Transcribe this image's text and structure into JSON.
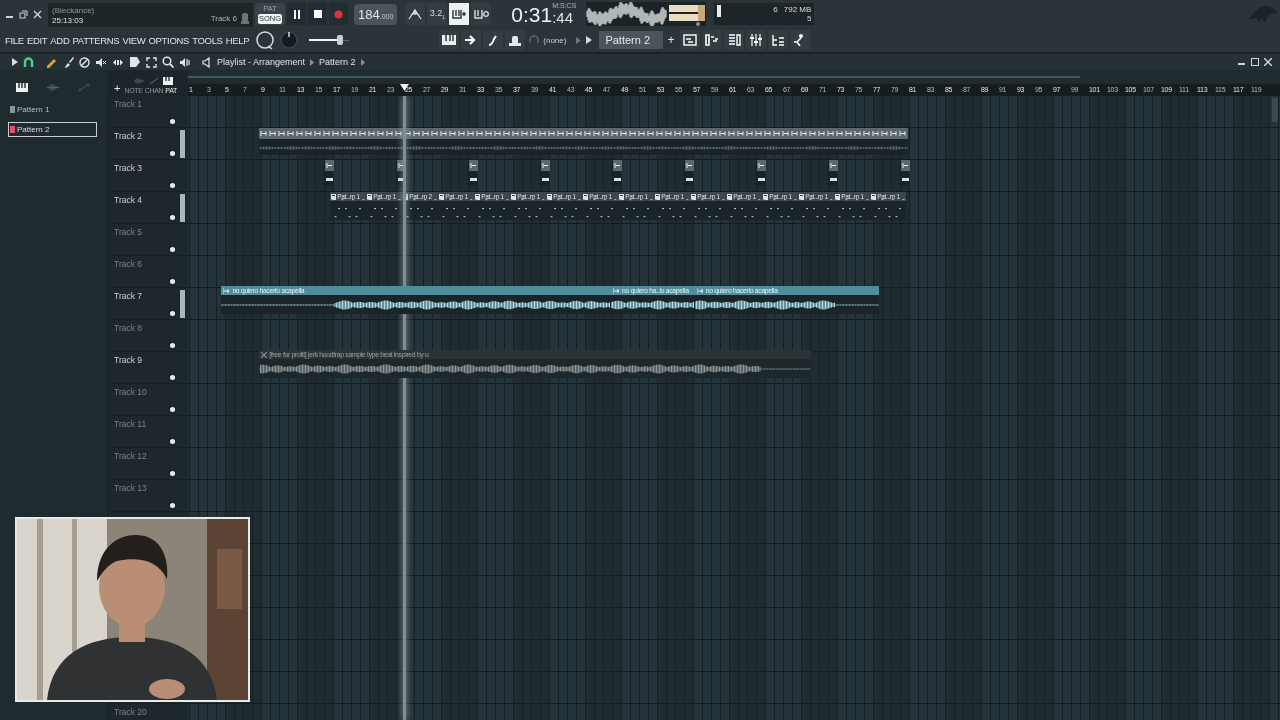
{
  "hint_panel": {
    "title": "(Bleckance)",
    "time": "25:13:03",
    "target": "Track 6"
  },
  "transport": {
    "modes": [
      {
        "label": "PAT",
        "selected": false
      },
      {
        "label": "SONG",
        "selected": true
      }
    ],
    "tempo": "184",
    "tempo_fraction": ".000"
  },
  "toggles": [
    {
      "kind": "metronome",
      "on": false
    },
    {
      "kind": "countdown",
      "label": "3.2$_{1}$",
      "on": false
    },
    {
      "kind": "step-edit",
      "on": true
    },
    {
      "kind": "blend",
      "on": false
    }
  ],
  "clock": {
    "format": "M:S:CS",
    "main": "0:31",
    "sub": ":44"
  },
  "monitor": {
    "readings": [
      "6",
      "792 MB",
      "5"
    ]
  },
  "master_volume": {
    "level": 0.78
  },
  "menu": [
    "FILE",
    "EDIT",
    "ADD",
    "PATTERNS",
    "VIEW",
    "OPTIONS",
    "TOOLS",
    "HELP"
  ],
  "channel_target": "(none)",
  "pattern_selector": {
    "value": "Pattern 2",
    "add": "+"
  },
  "playlist": {
    "title": "Playlist - Arrangement",
    "breadcrumb": "Pattern 2",
    "picker_tabs": [
      {
        "label": "NOTE",
        "selected": false
      },
      {
        "label": "CHAN",
        "selected": false
      },
      {
        "label": "PAT",
        "selected": true
      }
    ],
    "add": "+",
    "patterns": [
      {
        "name": "Pattern 1",
        "selected": false
      },
      {
        "name": "Pattern 2",
        "selected": true
      }
    ],
    "ruler": [
      "1",
      "3",
      "5",
      "7",
      "9",
      "11",
      "13",
      "15",
      "17",
      "19",
      "21",
      "23",
      "25",
      "27",
      "29",
      "31",
      "33",
      "35",
      "37",
      "39",
      "41",
      "43",
      "45",
      "47",
      "49",
      "51",
      "53",
      "55",
      "57",
      "59",
      "61",
      "63",
      "65",
      "67",
      "69",
      "71",
      "73",
      "75",
      "77",
      "79",
      "81",
      "83",
      "85",
      "87",
      "89",
      "91",
      "93",
      "95",
      "97",
      "99",
      "101",
      "103",
      "105",
      "107",
      "109",
      "111",
      "113",
      "115",
      "117",
      "119"
    ],
    "tracks": [
      {
        "name": "Track 1",
        "dimmed": true,
        "strip": false
      },
      {
        "name": "Track 2",
        "dimmed": false,
        "strip": true,
        "clips": [
          {
            "kind": "note-strip"
          }
        ]
      },
      {
        "name": "Track 3",
        "dimmed": false,
        "strip": false,
        "clips": [
          {
            "kind": "markers"
          }
        ]
      },
      {
        "name": "Track 4",
        "dimmed": false,
        "strip": true,
        "clips": [
          {
            "kind": "pattern",
            "label": "Pat...rn 1"
          },
          {
            "kind": "pattern",
            "label": "Pat...rn 1"
          },
          {
            "kind": "pattern",
            "label": "Pat...rn 2"
          },
          {
            "kind": "pattern",
            "label": "Pat...rn 1"
          },
          {
            "kind": "pattern",
            "label": "Pat...rn 1"
          },
          {
            "kind": "pattern",
            "label": "Pat...rn 1"
          },
          {
            "kind": "pattern",
            "label": "Pat...rn 1"
          },
          {
            "kind": "pattern",
            "label": "Pat...rn 1"
          },
          {
            "kind": "pattern",
            "label": "Pat...rn 1"
          },
          {
            "kind": "pattern",
            "label": "Pat...rn 1"
          },
          {
            "kind": "pattern",
            "label": "Pat...rn 1"
          },
          {
            "kind": "pattern",
            "label": "Pat...rn 1"
          },
          {
            "kind": "pattern",
            "label": "Pat...rn 1"
          },
          {
            "kind": "pattern",
            "label": "Pat...rn 1"
          },
          {
            "kind": "pattern",
            "label": "Pat...rn 1"
          },
          {
            "kind": "pattern",
            "label": "Pat...rn 1"
          }
        ]
      },
      {
        "name": "Track 5",
        "dimmed": true,
        "strip": false
      },
      {
        "name": "Track 6",
        "dimmed": true,
        "strip": false
      },
      {
        "name": "Track 7",
        "dimmed": false,
        "strip": true,
        "clips": [
          {
            "kind": "audio",
            "label": "no quiero hacerlo acapella",
            "muted": false
          },
          {
            "kind": "audio",
            "label": "no quiero ha..lo acapella",
            "muted": false
          },
          {
            "kind": "audio",
            "label": "no quiero hacerlo acapella",
            "muted": false
          }
        ]
      },
      {
        "name": "Track 8",
        "dimmed": true,
        "strip": false
      },
      {
        "name": "Track 9",
        "dimmed": false,
        "strip": false,
        "clips": [
          {
            "kind": "audio",
            "label": "[free for profit] jerk  hoodtrap  sample type beat inspired by u",
            "muted": true
          }
        ]
      },
      {
        "name": "Track 10",
        "dimmed": true,
        "strip": false
      },
      {
        "name": "Track 11",
        "dimmed": true,
        "strip": false
      },
      {
        "name": "Track 12",
        "dimmed": true,
        "strip": false
      },
      {
        "name": "Track 13",
        "dimmed": true,
        "strip": false
      },
      {
        "name": "Track 20",
        "dimmed": true,
        "strip": false
      }
    ]
  }
}
